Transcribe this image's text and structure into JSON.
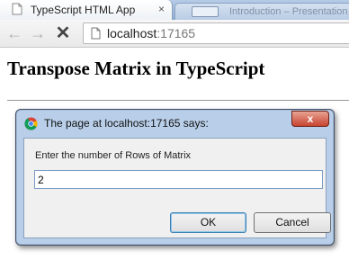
{
  "browser": {
    "tab": {
      "title": "TypeScript HTML App",
      "close_glyph": "×"
    },
    "background_tab": {
      "title": "Introduction – Presentation"
    },
    "nav": {
      "back_glyph": "←",
      "forward_glyph": "→",
      "stop_glyph": "✕"
    },
    "address": {
      "host": "localhost",
      "port": ":17165"
    }
  },
  "page": {
    "heading": "Transpose Matrix in TypeScript"
  },
  "dialog": {
    "title": "The page at localhost:17165 says:",
    "close_glyph": "x",
    "message": "Enter the number of Rows of Matrix",
    "input_value": "2",
    "ok_label": "OK",
    "cancel_label": "Cancel"
  },
  "colors": {
    "dialog_frame": "#b9cfe9",
    "close_button": "#c7442f",
    "tab_strip": "#9db9db"
  },
  "icons": {
    "tab_favicon": "page-icon",
    "address_icon": "page-icon",
    "dialog_icon": "chrome-icon"
  }
}
